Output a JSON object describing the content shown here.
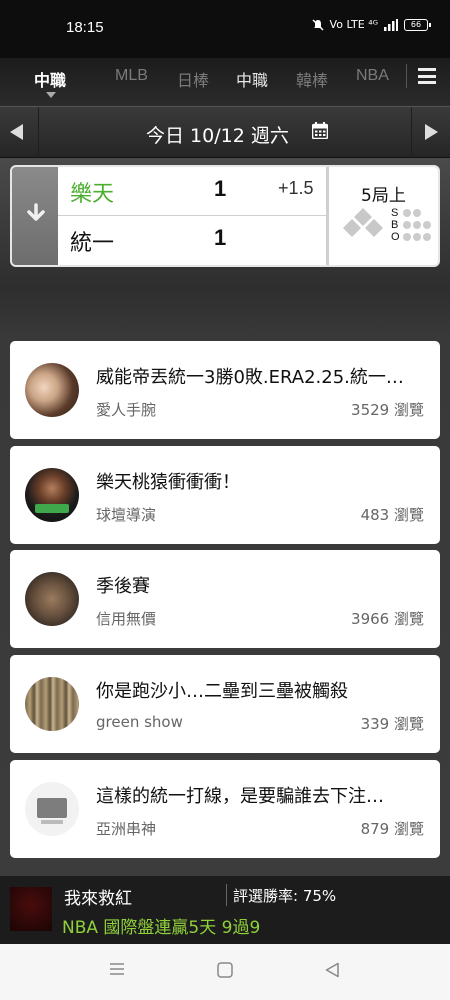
{
  "status_bar": {
    "time": "18:15",
    "network": "Vo LTE ⁴ᴳ",
    "battery": "66"
  },
  "nav": {
    "tabs": [
      {
        "label": "中職"
      },
      {
        "label": "MLB"
      },
      {
        "label": "日棒"
      },
      {
        "label": "中職"
      },
      {
        "label": "韓棒"
      },
      {
        "label": "NBA"
      }
    ]
  },
  "date_bar": {
    "label": "今日 10/12 週六"
  },
  "game": {
    "home_team": "樂天",
    "home_score": "1",
    "spread": "+1.5",
    "away_team": "統一",
    "away_score": "1",
    "inning": "5局上",
    "sbo": {
      "s": "S",
      "b": "B",
      "o": "O"
    }
  },
  "posts": [
    {
      "title": "威能帝丟統一3勝0敗.ERA2.25.統一…",
      "author": "愛人手腕",
      "views": "3529 瀏覽"
    },
    {
      "title": "樂天桃猿衝衝衝！",
      "author": "球壇導演",
      "views": "483 瀏覽"
    },
    {
      "title": "季後賽",
      "author": "信用無價",
      "views": "3966 瀏覽"
    },
    {
      "title": "你是跑沙小…二壘到三壘被觸殺",
      "author": "green show",
      "views": "339 瀏覽"
    },
    {
      "title": "這樣的統一打線，是要騙誰去下注…",
      "author": "亞洲串神",
      "views": "879 瀏覽"
    }
  ],
  "promo": {
    "name": "我來救紅",
    "rate": "評選勝率: 75%",
    "record": "NBA 國際盤連贏5天 9過9"
  },
  "colors": {
    "home_team": "#4caf30",
    "promo_record": "#8fd13a"
  }
}
